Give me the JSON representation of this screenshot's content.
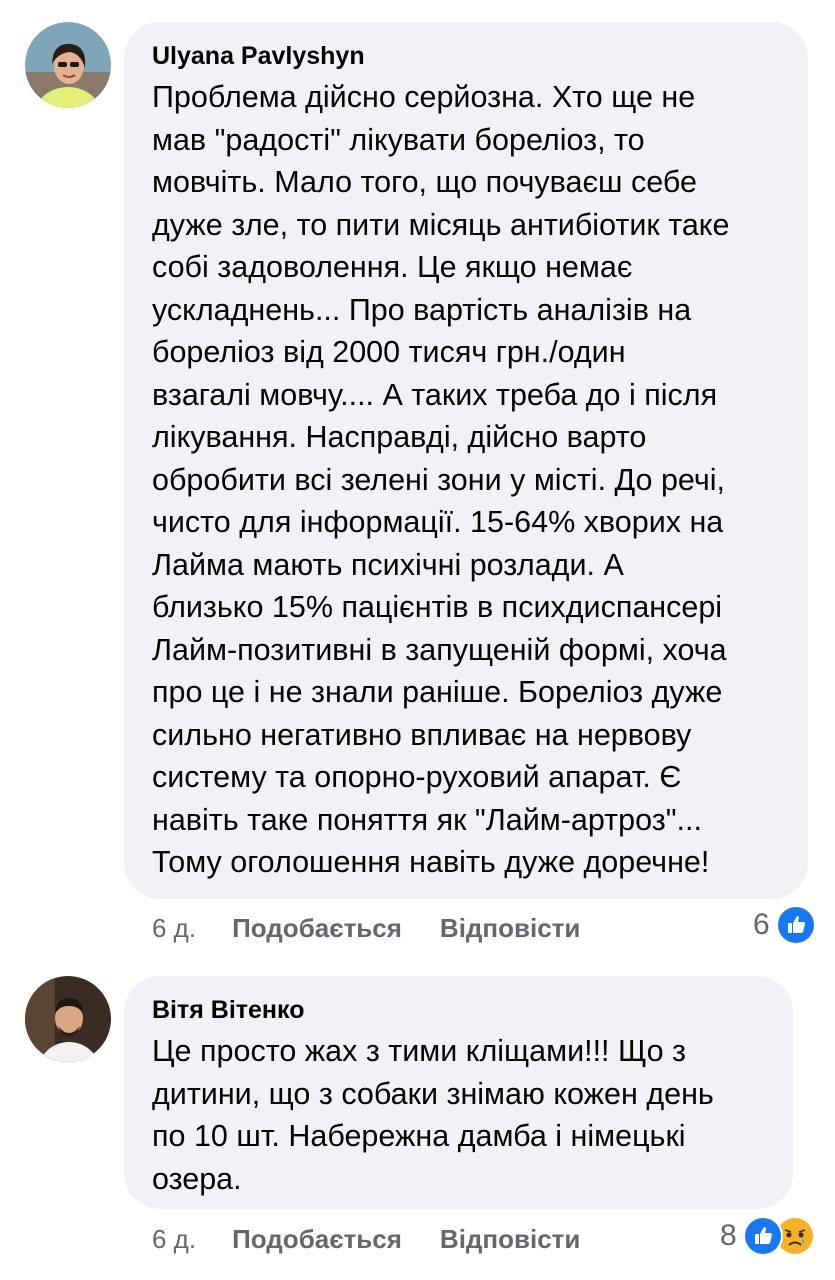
{
  "comments": [
    {
      "author": "Ulyana Pavlyshyn",
      "text": "Проблема дійсно серйозна. Хто ще не\nмав \"радості\" лікувати бореліоз, то\nмовчіть. Мало того, що почуваєш себе\nдуже зле, то пити місяць антибіотик таке\nсобі задоволення. Це якщо немає\nускладнень... Про вартість аналізів на\nбореліоз від 2000 тисяч грн./один\nвзагалі мовчу.... А таких треба до і після\nлікування. Насправді, дійсно варто\nобробити всі зелені зони у місті. До речі,\nчисто для інформації. 15-64% хворих на\nЛайма мають психічні розлади. А\nблизько 15% пацієнтів в психдиспансері\nЛайм-позитивні в запущеній формі, хоча\nпро це і не знали раніше. Бореліоз дуже\nсильно негативно впливає на нервову\nсистему та опорно-руховий апарат. Є\nнавіть таке поняття як \"Лайм-артроз\"...\nТому оголошення навіть дуже доречне!",
      "time": "6 д.",
      "like_label": "Подобається",
      "reply_label": "Відповісти",
      "reaction_count": "6",
      "reactions": [
        "like-icon"
      ]
    },
    {
      "author": "Вітя Вітенко",
      "text": "Це просто жах з тими кліщами!!! Що з\nдитини, що з собаки знімаю кожен день\nпо 10 шт. Набережна дамба і німецькі\nозера.",
      "time": "6 д.",
      "like_label": "Подобається",
      "reply_label": "Відповісти",
      "reaction_count": "8",
      "reactions": [
        "like-icon",
        "sad-icon"
      ]
    }
  ],
  "colors": {
    "bubble": "#f0f2f5",
    "meta_text": "#65676b",
    "like_blue": "#1877f2",
    "sad_yellow": "#f7b125"
  }
}
